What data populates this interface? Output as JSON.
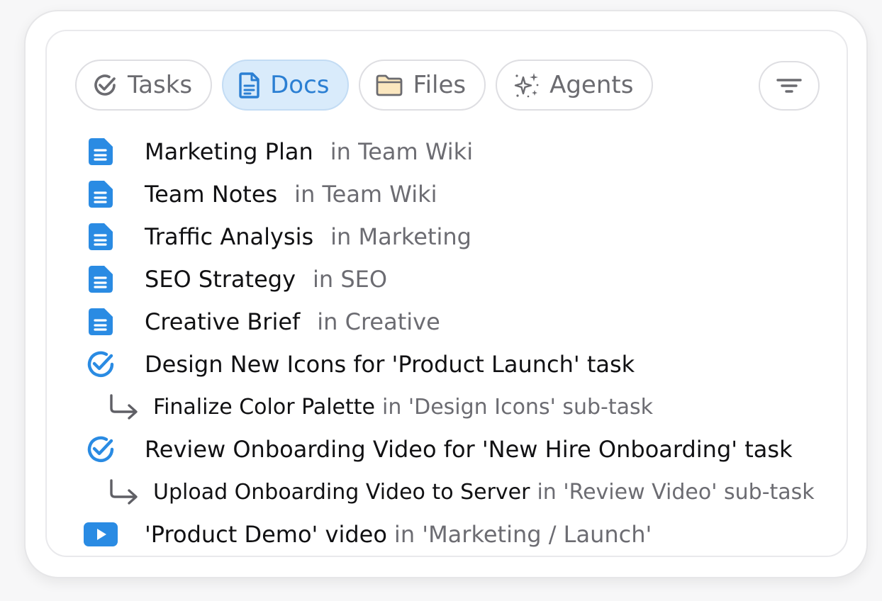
{
  "tabs": [
    {
      "label": "Tasks",
      "icon": "check-circle-icon",
      "active": false
    },
    {
      "label": "Docs",
      "icon": "document-icon",
      "active": true
    },
    {
      "label": "Files",
      "icon": "folder-icon",
      "active": false
    },
    {
      "label": "Agents",
      "icon": "sparkles-icon",
      "active": false
    }
  ],
  "filter": {
    "icon": "filter-icon"
  },
  "results": [
    {
      "icon": "doc-icon",
      "title": "Marketing Plan",
      "location": "in Team Wiki"
    },
    {
      "icon": "doc-icon",
      "title": "Team Notes",
      "location": "in Team Wiki"
    },
    {
      "icon": "doc-icon",
      "title": "Traffic Analysis",
      "location": "in Marketing"
    },
    {
      "icon": "doc-icon",
      "title": "SEO Strategy",
      "location": "in SEO"
    },
    {
      "icon": "doc-icon",
      "title": "Creative Brief",
      "location": "in Creative"
    },
    {
      "icon": "task-check-icon",
      "title": "Design New Icons for 'Product Launch' task",
      "location": ""
    },
    {
      "icon": "subtask-arrow-icon",
      "title": "Finalize Color Palette",
      "location": "in 'Design Icons' sub-task"
    },
    {
      "icon": "task-check-icon",
      "title": "Review Onboarding Video for 'New Hire Onboarding' task",
      "location": ""
    },
    {
      "icon": "subtask-arrow-icon",
      "title": "Upload Onboarding Video to Server",
      "location": "in 'Review Video' sub-task"
    },
    {
      "icon": "video-icon",
      "title": "'Product Demo' video",
      "location": "in 'Marketing / Launch'"
    }
  ],
  "colors": {
    "accent": "#2b7fd3",
    "doc_icon": "#2a8be3",
    "active_tab_bg": "#d9ebfb",
    "muted_text": "#6c6c72"
  }
}
